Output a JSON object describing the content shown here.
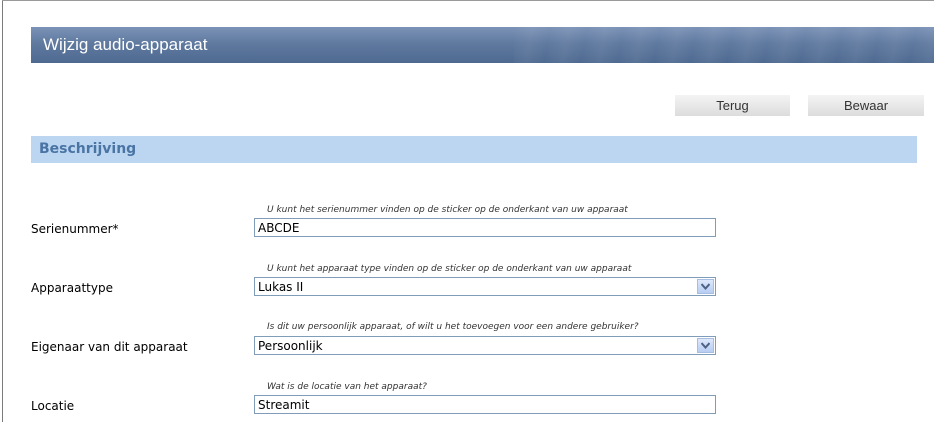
{
  "dialog": {
    "title": "Wijzig audio-apparaat"
  },
  "actions": {
    "back_label": "Terug",
    "save_label": "Bewaar"
  },
  "section": {
    "title": "Beschrijving"
  },
  "fields": [
    {
      "label": "Serienummer*",
      "hint": "U kunt het serienummer vinden op de sticker op de onderkant van uw apparaat",
      "value": "ABCDE",
      "type": "text"
    },
    {
      "label": "Apparaattype",
      "hint": "U kunt het apparaat type vinden op de sticker op de onderkant van uw apparaat",
      "value": "Lukas II",
      "type": "select"
    },
    {
      "label": "Eigenaar van dit apparaat",
      "hint": "Is dit uw persoonlijk apparaat, of wilt u het toevoegen voor een andere gebruiker?",
      "value": "Persoonlijk",
      "type": "select"
    },
    {
      "label": "Locatie",
      "hint": "Wat is de locatie van het apparaat?",
      "value": "Streamit",
      "type": "text"
    }
  ],
  "colors": {
    "title_bar": "#5f799f",
    "section_bar": "#bcd6f1",
    "section_text": "#4a74a4",
    "field_border": "#7f9db9"
  }
}
